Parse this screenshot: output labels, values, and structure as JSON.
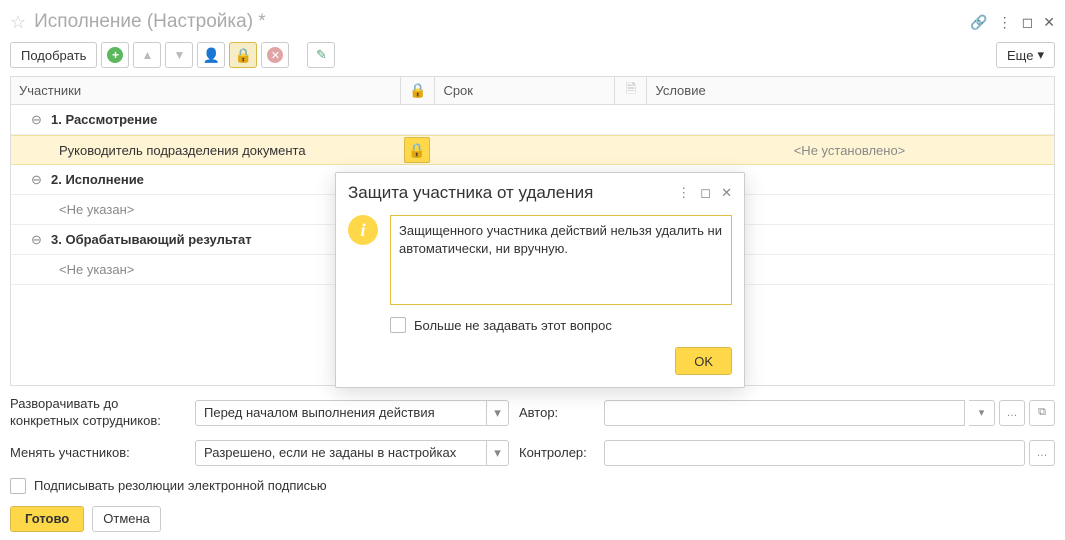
{
  "titlebar": {
    "title": "Исполнение (Настройка) *"
  },
  "toolbar": {
    "pick_label": "Подобрать",
    "more_label": "Еще"
  },
  "table": {
    "headers": {
      "participants": "Участники",
      "deadline": "Срок",
      "condition": "Условие"
    },
    "rows": [
      {
        "label": "1. Рассмотрение"
      },
      {
        "label": "Руководитель подразделения документа",
        "condition": "<Не установлено>"
      },
      {
        "label": "2. Исполнение"
      },
      {
        "label": "<Не указан>"
      },
      {
        "label": "3. Обрабатывающий результат"
      },
      {
        "label": "<Не указан>"
      }
    ]
  },
  "form": {
    "expand_label": "Разворачивать до конкретных сотрудников:",
    "expand_value": "Перед началом выполнения действия",
    "author_label": "Автор:",
    "change_label": "Менять участников:",
    "change_value": "Разрешено, если не заданы в настройках",
    "controller_label": "Контролер:",
    "sign_label": "Подписывать резолюции электронной подписью",
    "done_label": "Готово",
    "cancel_label": "Отмена"
  },
  "dialog": {
    "title": "Защита участника от удаления",
    "message": "Защищенного участника действий нельзя удалить ни автоматически, ни вручную.",
    "dont_ask": "Больше не задавать этот вопрос",
    "ok_label": "OK"
  }
}
